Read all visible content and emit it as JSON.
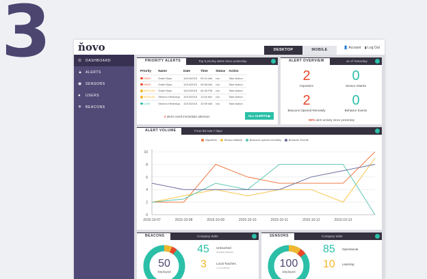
{
  "step_number": "3",
  "app": {
    "logo": "ňovo"
  },
  "topbar": {
    "tab_desktop": "DESKTOP",
    "tab_mobile": "MOBILE",
    "account": "Account",
    "logout": "Log Out"
  },
  "sidebar": {
    "items": [
      {
        "label": "DASHBOARD",
        "icon": "dashboard-icon",
        "glyph": "⊙"
      },
      {
        "label": "ALERTS",
        "icon": "bell-icon",
        "glyph": "▲"
      },
      {
        "label": "SENSORS",
        "icon": "sensor-icon",
        "glyph": "◉"
      },
      {
        "label": "USERS",
        "icon": "user-icon",
        "glyph": "●"
      },
      {
        "label": "BEACONS",
        "icon": "beacon-icon",
        "glyph": "✳"
      }
    ]
  },
  "priority_alerts": {
    "title": "PRIORITY ALERTS",
    "subtitle": "Top 5 priority alerts since yesterday",
    "columns": [
      "Priority",
      "Name",
      "Date",
      "Time",
      "Status",
      "Action"
    ],
    "rows": [
      {
        "priority": "HIGH",
        "color": "#e8472a",
        "name": "Gabe Ryan",
        "date": "10/14/2015",
        "time": "09:10 AM",
        "status": "n/a",
        "action": "Take Action"
      },
      {
        "priority": "HIGH",
        "color": "#e8472a",
        "name": "Gabe Ryan",
        "date": "10/14/2015",
        "time": "09:08 AM",
        "status": "n/a",
        "action": "Take Action"
      },
      {
        "priority": "MEDIUM",
        "color": "#f2b72e",
        "name": "Gabe Ryan",
        "date": "10/13/2015",
        "time": "04:39 PM",
        "status": "n/a",
        "action": "Take Action"
      },
      {
        "priority": "MEDIUM",
        "color": "#f2b72e",
        "name": "Shlomo Hershkop",
        "date": "10/13/2015",
        "time": "11:54 AM",
        "status": "n/a",
        "action": "Take Action"
      },
      {
        "priority": "LOW",
        "color": "#2bbfa8",
        "name": "Shlomo Hershkop",
        "date": "10/13/2015",
        "time": "10:59 AM",
        "status": "n/a",
        "action": "Take Action"
      }
    ],
    "footer_count": "2",
    "footer_text": "alerts need immediate attention",
    "button": "ALL ALERTS ▶"
  },
  "alert_overview": {
    "title": "ALERT OVERVIEW",
    "subtitle": "as of Yesterday",
    "stats": [
      {
        "value": "2",
        "label": "Imposters",
        "color": "#e8472a"
      },
      {
        "value": "0",
        "label": "Sensor Attacks",
        "color": "#2bbfa8"
      },
      {
        "value": "2",
        "label": "Beacons Opened Remotely",
        "color": "#e8472a"
      },
      {
        "value": "0",
        "label": "Behavior Events",
        "color": "#2bbfa8"
      }
    ],
    "footer_change": "-50%",
    "footer_text": "alert activity since yesterday"
  },
  "alert_volume": {
    "title": "ALERT VOLUME",
    "subtitle": "From the last 7 days"
  },
  "chart_data": {
    "type": "line",
    "x": [
      "2015-10-07",
      "2015-10-08",
      "2015-10-09",
      "2015-10-10",
      "2015-10-11",
      "2015-10-12",
      "2015-10-13",
      "2015-10-14"
    ],
    "ylim": [
      0,
      10
    ],
    "yticks": [
      0,
      2,
      4,
      6,
      8,
      10
    ],
    "xticks": [
      "2015-10-07",
      "2015-10-08",
      "2015-10-09",
      "2015-10-10",
      "2015-10-11",
      "2015-10-12",
      "2015-10-13"
    ],
    "grid": true,
    "legend_position": "top",
    "series": [
      {
        "name": "Imposters",
        "color": "#f07a43",
        "values": [
          2,
          2,
          8,
          6,
          5,
          5,
          5,
          10
        ]
      },
      {
        "name": "Sensor Attacks",
        "color": "#f7c64c",
        "values": [
          2,
          3,
          4,
          3,
          4,
          4,
          2,
          9
        ]
      },
      {
        "name": "Beacons opened remotely",
        "color": "#5ec7b4",
        "values": [
          2,
          2.5,
          5,
          4,
          8,
          8,
          8,
          0
        ]
      },
      {
        "name": "Behavior Events",
        "color": "#6c6d9d",
        "values": [
          5,
          4,
          4,
          4,
          4,
          6,
          7,
          8
        ]
      }
    ]
  },
  "beacons": {
    "title": "BEACONS",
    "subtitle": "Company Wide",
    "deployed_value": "50",
    "deployed_label": "Deployed",
    "stats": [
      {
        "value": "45",
        "label": "Untouched",
        "sub": "Unused devices",
        "color": "#2bbfa8"
      },
      {
        "value": "3",
        "label": "Local Touches",
        "sub": "1 in a device",
        "color": "#f2b72e"
      }
    ]
  },
  "sensors": {
    "title": "SENSORS",
    "subtitle": "Company Wide",
    "deployed_value": "100",
    "deployed_label": "Deployed",
    "stats": [
      {
        "value": "85",
        "label": "Operational",
        "color": "#2bbfa8"
      },
      {
        "value": "10",
        "label": "Learning",
        "color": "#f2b72e"
      }
    ]
  },
  "colors": {
    "sidebar": "#524a76",
    "dark": "#35313f",
    "accent": "#2bbfa8",
    "red": "#e8472a",
    "yellow": "#f2b72e"
  }
}
